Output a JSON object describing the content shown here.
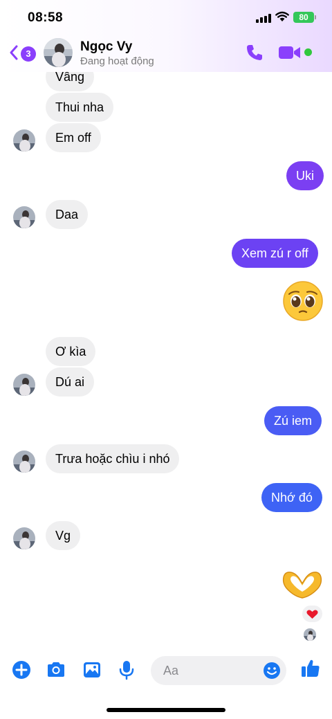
{
  "status_bar": {
    "time": "08:58",
    "battery": "80"
  },
  "header": {
    "back_badge": "3",
    "contact_name": "Ngọc Vy",
    "contact_status": "Đang hoạt động",
    "icons": [
      "back-chevron-icon",
      "phone-icon",
      "video-camera-icon"
    ]
  },
  "messages": [
    {
      "side": "in",
      "text": "Vâng"
    },
    {
      "side": "in",
      "text": "Thui nha"
    },
    {
      "side": "in",
      "text": "Em off"
    },
    {
      "side": "out",
      "text": "Uki"
    },
    {
      "side": "in",
      "text": "Daa"
    },
    {
      "side": "out",
      "text": "Xem zú r off"
    },
    {
      "side": "out",
      "text": "🥹"
    },
    {
      "side": "in",
      "text": "Ơ kìa"
    },
    {
      "side": "in",
      "text": "Dú ai"
    },
    {
      "side": "out",
      "text": "Zú iem"
    },
    {
      "side": "in",
      "text": "Trưa hoặc chìu i nhó"
    },
    {
      "side": "out",
      "text": "Nhớ đó"
    },
    {
      "side": "in",
      "text": "Vg"
    },
    {
      "side": "out",
      "text": "🫶"
    }
  ],
  "reaction": "❤️",
  "composer": {
    "placeholder": "Aa",
    "icons": [
      "plus-icon",
      "camera-icon",
      "image-icon",
      "microphone-icon",
      "emoji-icon",
      "thumbs-up-icon"
    ]
  },
  "colors": {
    "accent_purple": "#8a3ffc",
    "bubble_out_top": "#7b3ff2",
    "bubble_out_bottom": "#3e63f5",
    "bubble_in": "#efeff0",
    "online": "#31c83d"
  }
}
